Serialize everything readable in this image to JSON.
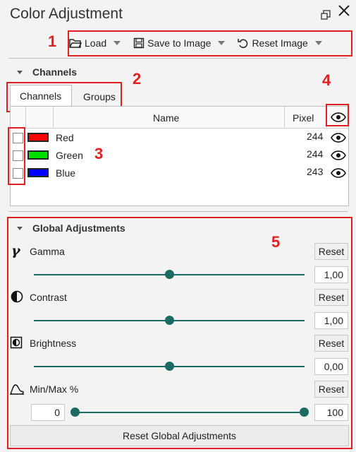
{
  "window": {
    "title": "Color Adjustment"
  },
  "toolbar": {
    "load": "Load",
    "save": "Save to Image",
    "reset": "Reset Image"
  },
  "annotations": {
    "n1": "1",
    "n2": "2",
    "n3": "3",
    "n4": "4",
    "n5": "5"
  },
  "channels_section": {
    "title": "Channels",
    "tabs": [
      {
        "label": "Channels",
        "active": true
      },
      {
        "label": "Groups",
        "active": false
      }
    ],
    "columns": {
      "name": "Name",
      "pixel": "Pixel"
    },
    "rows": [
      {
        "name": "Red",
        "color": "#ff0000",
        "pixel": "244"
      },
      {
        "name": "Green",
        "color": "#00e000",
        "pixel": "244"
      },
      {
        "name": "Blue",
        "color": "#0000ff",
        "pixel": "243"
      }
    ]
  },
  "global": {
    "title": "Global Adjustments",
    "gamma": {
      "label": "Gamma",
      "reset": "Reset",
      "value": "1,00",
      "level": 0.5
    },
    "contrast": {
      "label": "Contrast",
      "reset": "Reset",
      "value": "1,00",
      "level": 0.5
    },
    "brightness": {
      "label": "Brightness",
      "reset": "Reset",
      "value": "0,00",
      "level": 0.5
    },
    "minmax": {
      "label": "Min/Max %",
      "reset": "Reset",
      "min": "0",
      "max": "100"
    },
    "reset_all": "Reset Global Adjustments"
  },
  "colors": {
    "accent": "#1b6b63",
    "annotation": "#e02020"
  }
}
